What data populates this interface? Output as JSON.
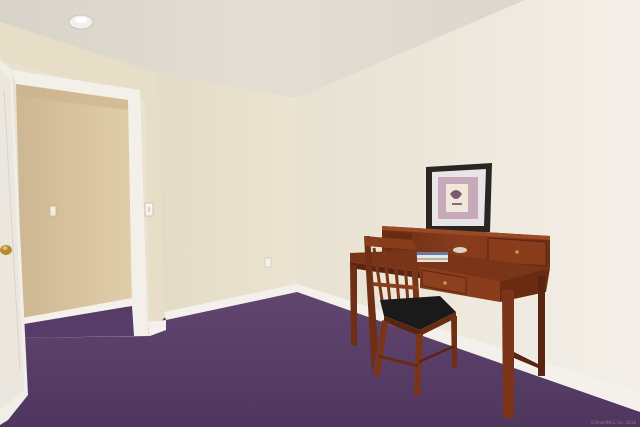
{
  "scene": {
    "kind": "photo",
    "subject": "bedroom-office",
    "colors": {
      "ceiling": "#ded9cf",
      "wall_left": "#e8e0c8",
      "wall_right": "#ede7db",
      "wall_right_light": "#f3efe8",
      "carpet": "#5a3f6a",
      "baseboard": "#f4f1ec",
      "wood": "#7a3418",
      "wood_dark": "#4e1f0c",
      "closet_wall": "#dcc8a6",
      "door": "#f3f0ea",
      "chair_seat": "#1b1a1a"
    }
  },
  "watermark": {
    "text": "©SmartMLS, Inc. 2018"
  }
}
